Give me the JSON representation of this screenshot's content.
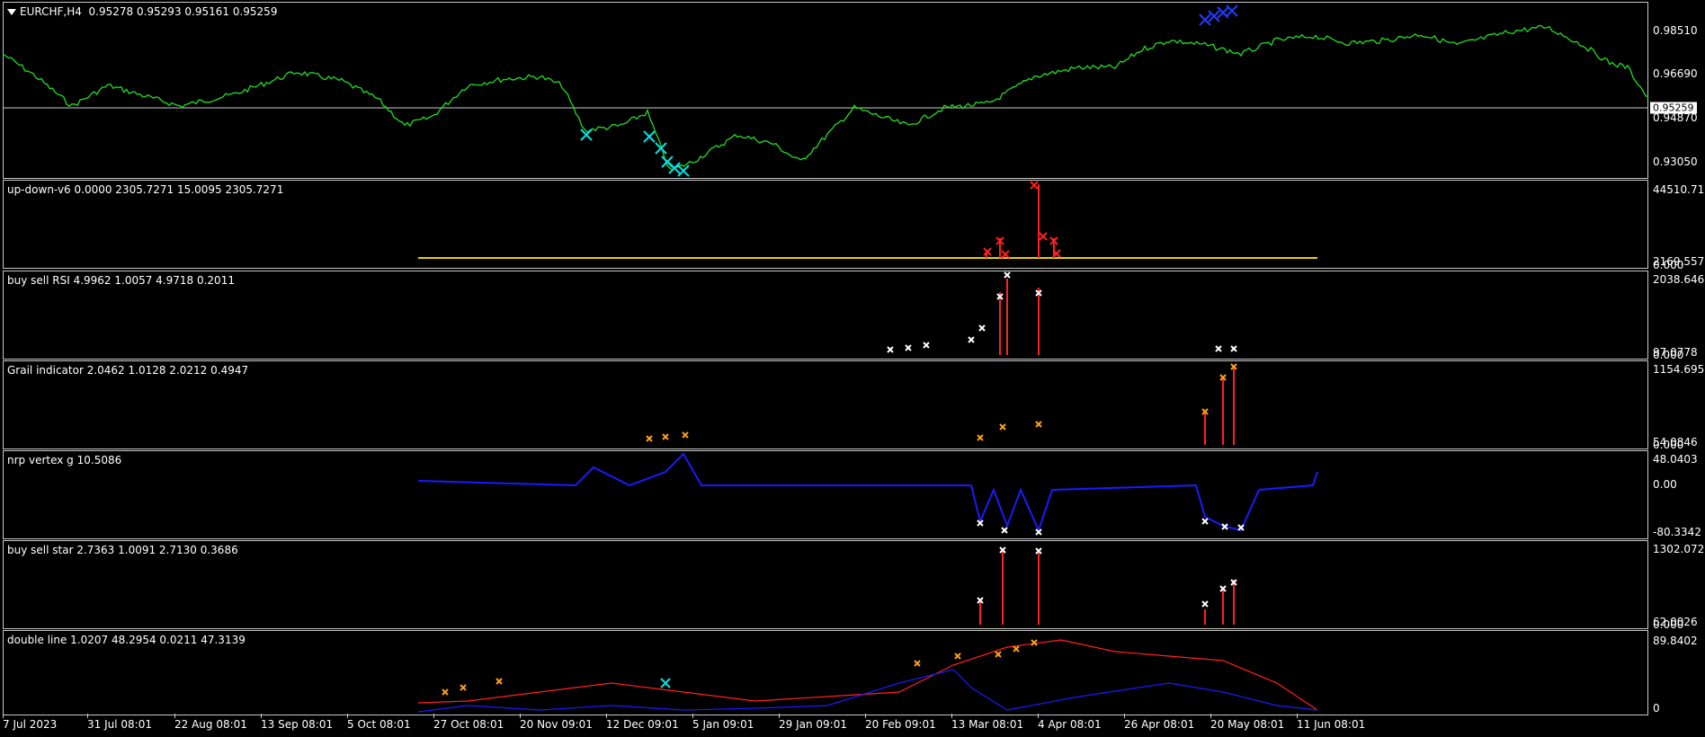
{
  "main": {
    "title": "EURCHF,H4  0.95278 0.95293 0.95161 0.95259",
    "axis": [
      "0.98510",
      "0.96690",
      "0.94870",
      "0.93050"
    ],
    "current_price": "0.95259"
  },
  "indicators": [
    {
      "title": "up-down-v6 0.0000 2305.7271 15.0095 2305.7271",
      "axis": [
        "44510.716",
        "2169.5579",
        "0.000"
      ]
    },
    {
      "title": "buy sell RSI 4.9962 1.0057 4.9718 0.2011",
      "axis": [
        "2038.646",
        "97.0778",
        "0.000"
      ]
    },
    {
      "title": "Grail indicator 2.0462 1.0128 2.0212 0.4947",
      "axis": [
        "1154.6957",
        "54.0846",
        "0.000"
      ]
    },
    {
      "title": "nrp vertex g 10.5086",
      "axis": [
        "48.0403",
        "0.00",
        "-80.3342"
      ]
    },
    {
      "title": "buy sell star 2.7363 1.0091 2.7130 0.3686",
      "axis": [
        "1302.0729",
        "62.0026",
        "0.000"
      ]
    },
    {
      "title": "double line 1.0207 48.2954 0.0211 47.3139",
      "axis": [
        "89.8402",
        "0"
      ]
    }
  ],
  "time_axis": [
    "7 Jul 2023",
    "31 Jul 08:01",
    "22 Aug 08:01",
    "13 Sep 08:01",
    "5 Oct 08:01",
    "27 Oct 08:01",
    "20 Nov 09:01",
    "12 Dec 09:01",
    "5 Jan 09:01",
    "29 Jan 09:01",
    "20 Feb 09:01",
    "13 Mar 08:01",
    "4 Apr 08:01",
    "26 Apr 08:01",
    "20 May 08:01",
    "11 Jun 08:01"
  ],
  "colors": {
    "price_line": "#22dd22",
    "buy_marker": "#00e5e5",
    "sell_marker": "#1f3cff",
    "histogram": "#ff2020",
    "orange_marker": "#ff9f1a",
    "vertex": "#1a1aff",
    "yellow_line": "#e8d000",
    "grid": "#c8c8c8"
  }
}
